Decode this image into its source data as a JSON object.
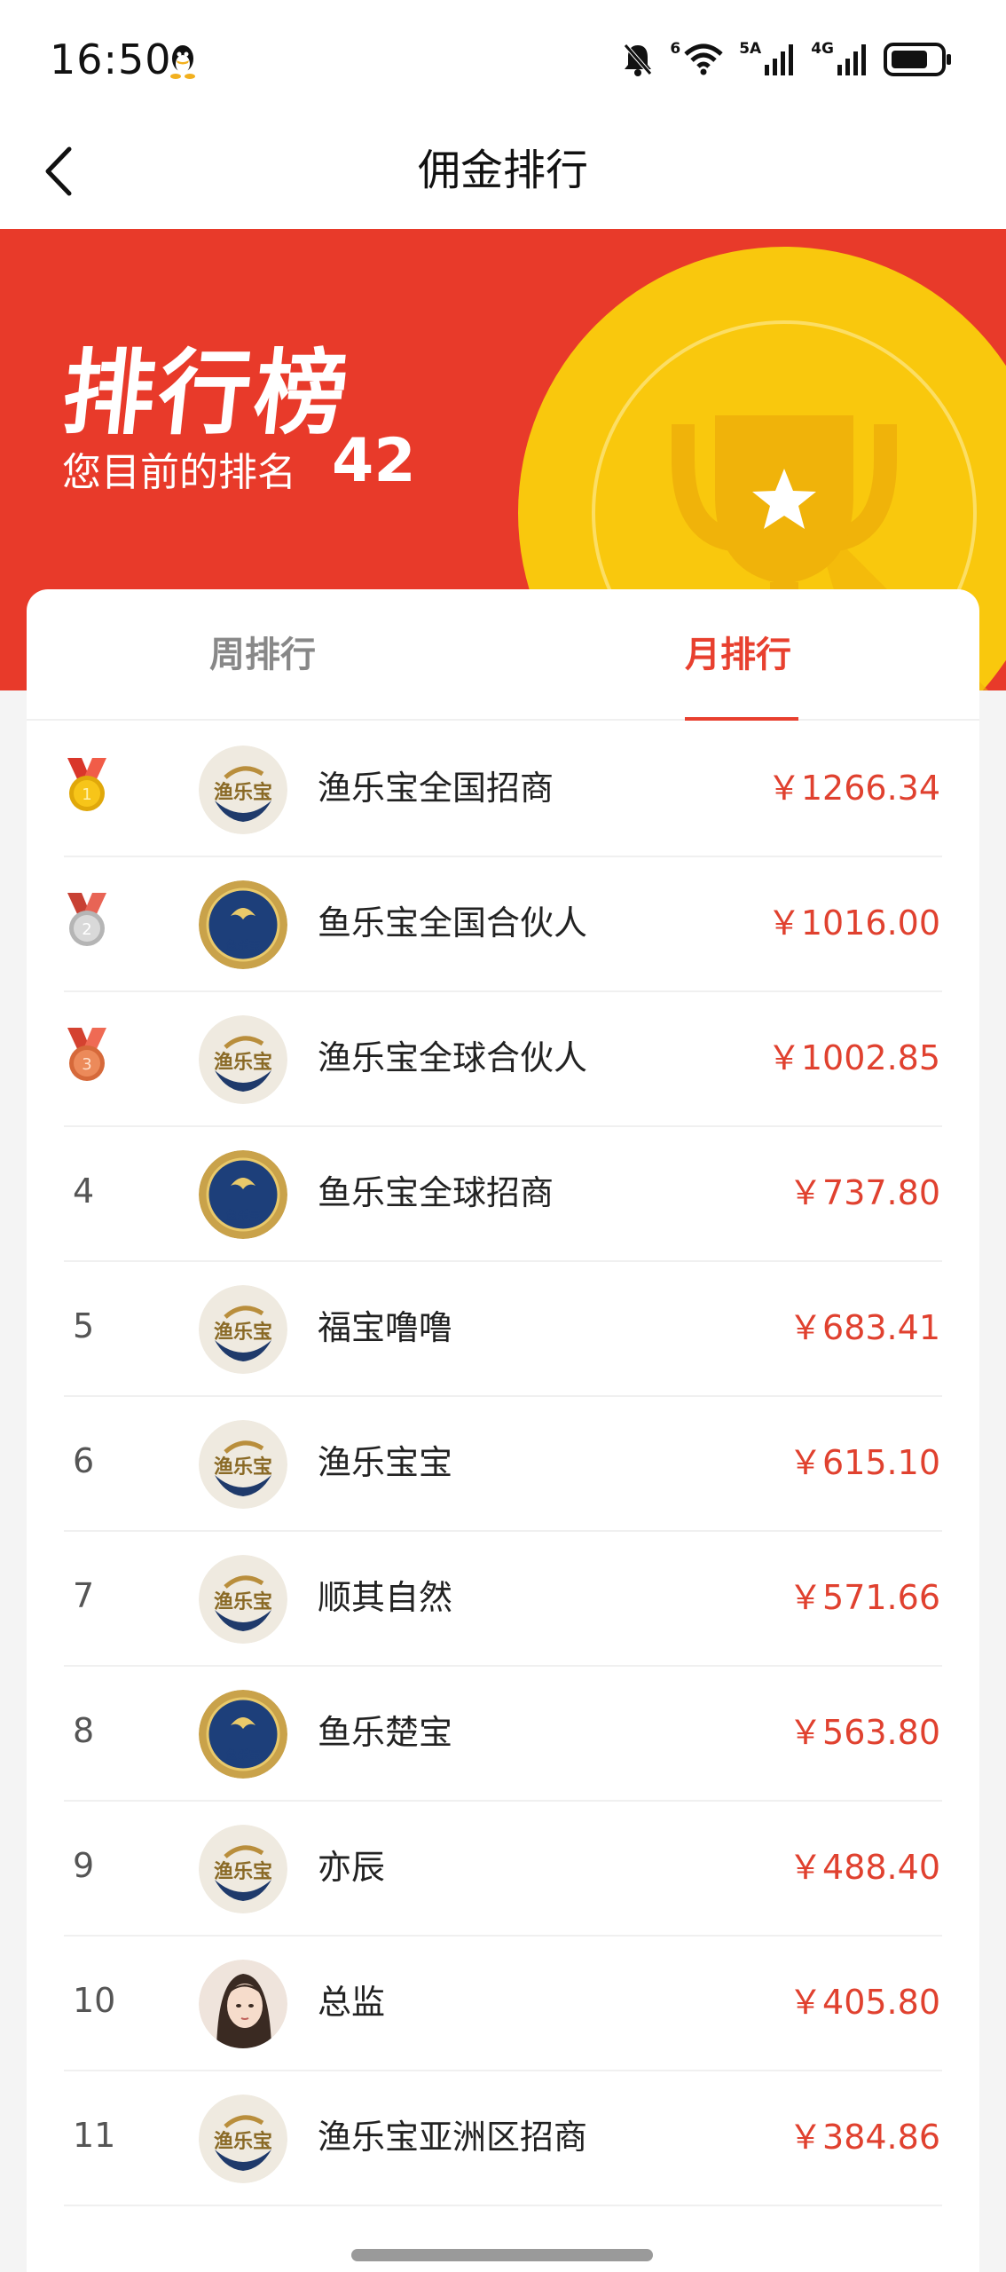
{
  "status_bar": {
    "time": "16:50",
    "net1": "5A",
    "net2": "4G",
    "wifi_sub": "6"
  },
  "nav": {
    "title": "佣金排行"
  },
  "hero": {
    "title": "排行榜",
    "rank_label": "您目前的排名",
    "rank_value": "42",
    "colors": {
      "background": "#e83a2a",
      "disc": "#f9c80d"
    }
  },
  "tabs": [
    {
      "label": "周排行",
      "active": false
    },
    {
      "label": "月排行",
      "active": true
    }
  ],
  "ranking": [
    {
      "rank": "1",
      "medal": "gold-medal-icon",
      "avatar": "yulebao-logo-light",
      "name": "渔乐宝全国招商",
      "amount": "￥1266.34"
    },
    {
      "rank": "2",
      "medal": "silver-medal-icon",
      "avatar": "yulebao-logo-dark",
      "name": "鱼乐宝全国合伙人",
      "amount": "￥1016.00"
    },
    {
      "rank": "3",
      "medal": "bronze-medal-icon",
      "avatar": "yulebao-logo-light",
      "name": "渔乐宝全球合伙人",
      "amount": "￥1002.85"
    },
    {
      "rank": "4",
      "medal": "",
      "avatar": "yulebao-logo-dark",
      "name": "鱼乐宝全球招商",
      "amount": "￥737.80"
    },
    {
      "rank": "5",
      "medal": "",
      "avatar": "yulebao-logo-light",
      "name": "福宝噜噜",
      "amount": "￥683.41"
    },
    {
      "rank": "6",
      "medal": "",
      "avatar": "yulebao-logo-light",
      "name": "渔乐宝宝",
      "amount": "￥615.10"
    },
    {
      "rank": "7",
      "medal": "",
      "avatar": "yulebao-logo-light",
      "name": "顺其自然",
      "amount": "￥571.66"
    },
    {
      "rank": "8",
      "medal": "",
      "avatar": "yulebao-logo-dark",
      "name": "鱼乐楚宝",
      "amount": "￥563.80"
    },
    {
      "rank": "9",
      "medal": "",
      "avatar": "yulebao-logo-light",
      "name": "亦辰",
      "amount": "￥488.40"
    },
    {
      "rank": "10",
      "medal": "",
      "avatar": "portrait-photo",
      "name": "总监",
      "amount": "￥405.80"
    },
    {
      "rank": "11",
      "medal": "",
      "avatar": "yulebao-logo-light",
      "name": "渔乐宝亚洲区招商",
      "amount": "￥384.86"
    }
  ],
  "logo_texts": {
    "light": "渔乐宝",
    "dark": "鱼乐宝"
  },
  "accent_color": "#e0412f"
}
